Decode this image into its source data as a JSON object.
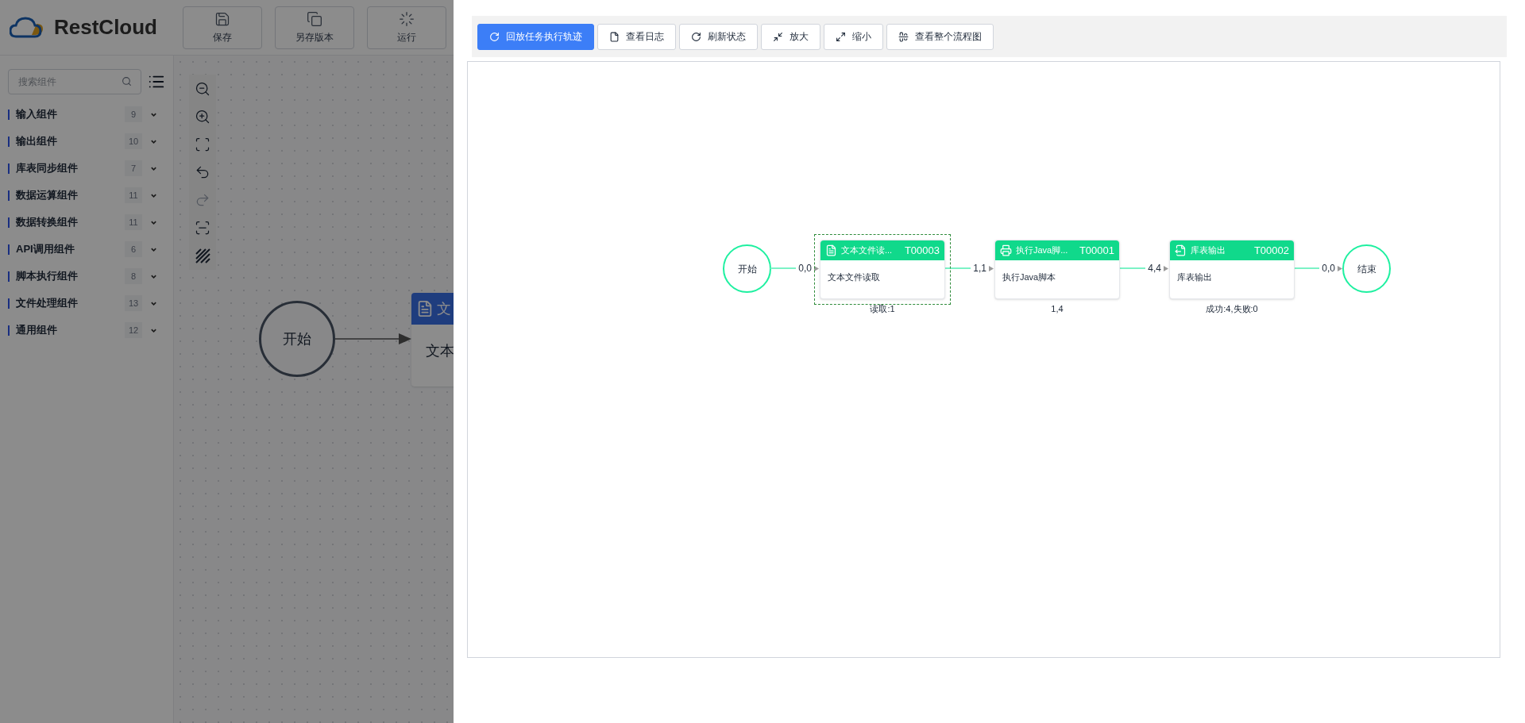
{
  "app": {
    "logo": "RestCloud",
    "toolbar": [
      {
        "label": "保存",
        "kind": "save"
      },
      {
        "label": "另存版本",
        "kind": "copy"
      },
      {
        "label": "运行",
        "kind": "run"
      }
    ],
    "search": {
      "placeholder": "搜索组件"
    },
    "categories": [
      {
        "name": "输入组件",
        "count": "9"
      },
      {
        "name": "输出组件",
        "count": "10"
      },
      {
        "name": "库表同步组件",
        "count": "7"
      },
      {
        "name": "数据运算组件",
        "count": "11"
      },
      {
        "name": "数据转换组件",
        "count": "11"
      },
      {
        "name": "API调用组件",
        "count": "6"
      },
      {
        "name": "脚本执行组件",
        "count": "8"
      },
      {
        "name": "文件处理组件",
        "count": "13"
      },
      {
        "name": "通用组件",
        "count": "12"
      }
    ],
    "canvas_tools": [
      {
        "kind": "zoom-out",
        "disabled": false
      },
      {
        "kind": "zoom-in",
        "disabled": false
      },
      {
        "kind": "fit",
        "disabled": false
      },
      {
        "kind": "undo",
        "disabled": false
      },
      {
        "kind": "redo",
        "disabled": true
      },
      {
        "kind": "frame",
        "disabled": false
      },
      {
        "kind": "hatch",
        "disabled": false
      }
    ],
    "canvas": {
      "start": "开始",
      "node_title": "文",
      "node_body": "文本"
    }
  },
  "drawer": {
    "toolbar": [
      {
        "label": "回放任务执行轨迹",
        "kind": "replay",
        "primary": true
      },
      {
        "label": "查看日志",
        "kind": "log",
        "primary": false
      },
      {
        "label": "刷新状态",
        "kind": "refresh",
        "primary": false
      },
      {
        "label": "放大",
        "kind": "zoom-in",
        "primary": false
      },
      {
        "label": "缩小",
        "kind": "zoom-out",
        "primary": false
      },
      {
        "label": "查看整个流程图",
        "kind": "fit",
        "primary": false
      }
    ],
    "diagram": {
      "start": "开始",
      "end": "结束",
      "nodes": [
        {
          "title": "文本文件读...",
          "code": "T00003",
          "body": "文本文件读取",
          "stat": "读取:1",
          "kind": "file",
          "selected": true
        },
        {
          "title": "执行Java脚...",
          "code": "T00001",
          "body": "执行Java脚本",
          "stat": "1,4",
          "kind": "script",
          "selected": false
        },
        {
          "title": "库表输出",
          "code": "T00002",
          "body": "库表输出",
          "stat": "成功:4,失败:0",
          "kind": "output",
          "selected": false
        }
      ],
      "edges": [
        "0,0",
        "1,1",
        "4,4",
        "0,0"
      ]
    }
  }
}
